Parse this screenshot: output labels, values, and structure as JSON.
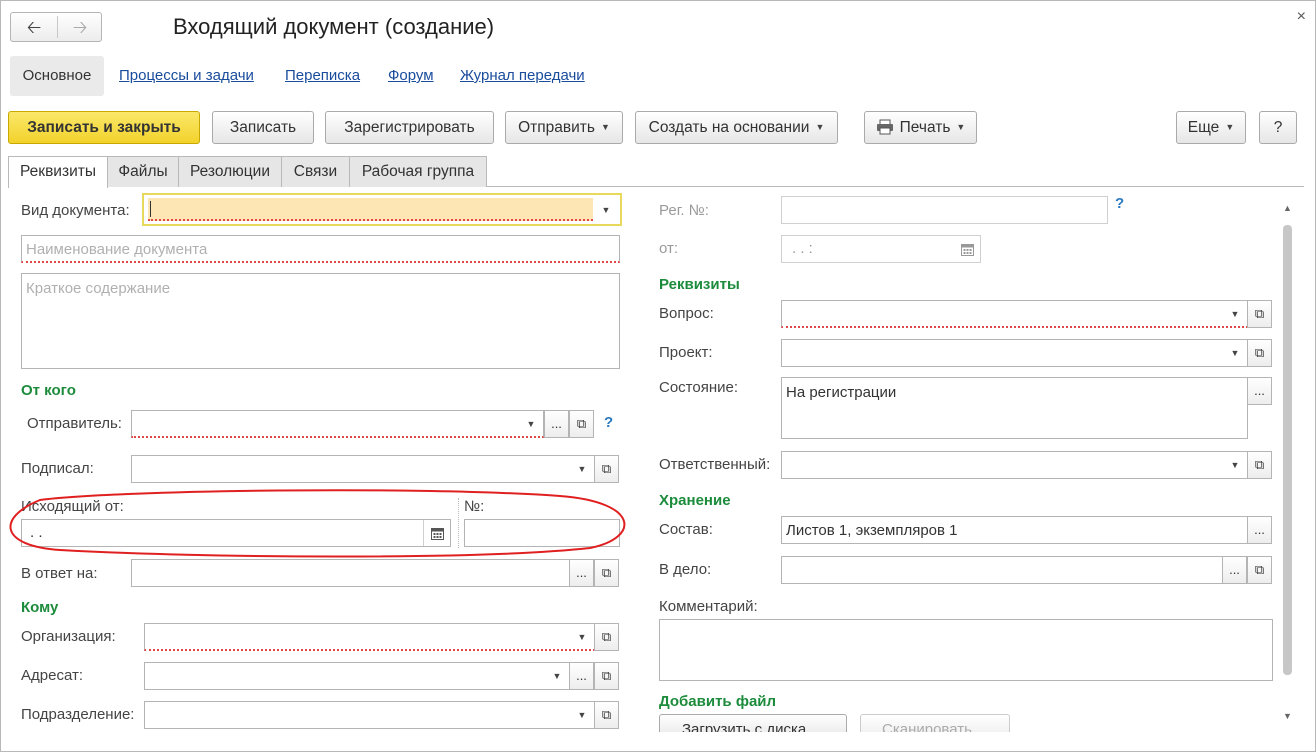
{
  "window": {
    "title": "Входящий документ (создание)",
    "back_icon": "arrow-left-icon",
    "forward_icon": "arrow-right-icon",
    "close": "×"
  },
  "nav": {
    "active": "Основное",
    "links": [
      "Процессы и задачи",
      "Переписка",
      "Форум",
      "Журнал передачи"
    ]
  },
  "toolbar": {
    "save_close": "Записать и закрыть",
    "save": "Записать",
    "register": "Зарегистрировать",
    "send": "Отправить",
    "create_based": "Создать на основании",
    "print": "Печать",
    "more": "Еще",
    "help": "?",
    "accent": "#f2d22b"
  },
  "tabs": [
    "Реквизиты",
    "Файлы",
    "Резолюции",
    "Связи",
    "Рабочая группа"
  ],
  "left": {
    "doc_type_label": "Вид документа:",
    "doc_type_value": "",
    "doc_name_placeholder": "Наименование документа",
    "summary_placeholder": "Краткое содержание",
    "from_section": "От кого",
    "sender_label": "Отправитель:",
    "signed_label": "Подписал:",
    "outgoing_from_label": "Исходящий от:",
    "outgoing_date_value": " .  .",
    "number_label": "№:",
    "reply_label": "В ответ на:",
    "to_section": "Кому",
    "org_label": "Организация:",
    "addressee_label": "Адресат:",
    "dept_label": "Подразделение:"
  },
  "right": {
    "reg_no_label": "Рег. №:",
    "from_label": "от:",
    "from_value": " .  .      :",
    "requisites_section": "Реквизиты",
    "question_label": "Вопрос:",
    "project_label": "Проект:",
    "state_label": "Состояние:",
    "state_value": "На регистрации",
    "responsible_label": "Ответственный:",
    "storage_section": "Хранение",
    "composition_label": "Состав:",
    "composition_value": "Листов 1, экземпляров 1",
    "file_label": "В дело:",
    "comment_label": "Комментарий:",
    "add_file_section": "Добавить файл",
    "upload_btn": "Загрузить с диска",
    "scan_btn": "Сканировать"
  },
  "colors": {
    "section": "#1c8c3c",
    "link": "#1a4c9c",
    "annotation": "#e02020"
  }
}
